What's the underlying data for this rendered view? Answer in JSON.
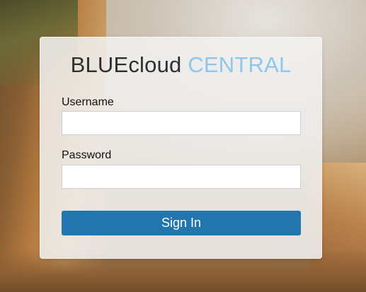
{
  "login": {
    "title_brand": "BLUEcloud",
    "title_product": "CENTRAL",
    "username_label": "Username",
    "username_value": "",
    "password_label": "Password",
    "password_value": "",
    "submit_label": "Sign In"
  },
  "colors": {
    "brand_text": "#2f2f2f",
    "product_text": "#8cc8ee",
    "button_bg": "#2275ad",
    "button_text": "#ffffff"
  }
}
